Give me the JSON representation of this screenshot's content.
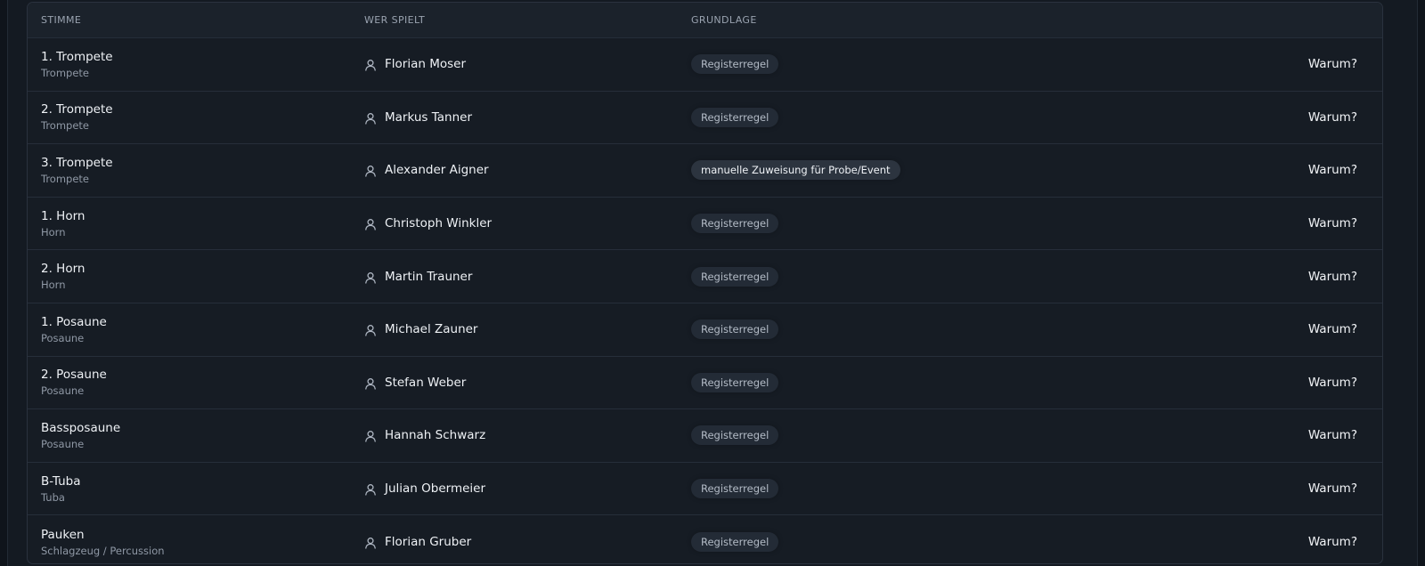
{
  "header": {
    "col_stimme": "STIMME",
    "col_wer": "WER SPIELT",
    "col_grundlage": "GRUNDLAGE"
  },
  "rows": [
    {
      "voice": "1. Trompete",
      "section": "Trompete",
      "player": "Florian Moser",
      "basis": "Registerregel",
      "manual": false,
      "action": "Warum?"
    },
    {
      "voice": "2. Trompete",
      "section": "Trompete",
      "player": "Markus Tanner",
      "basis": "Registerregel",
      "manual": false,
      "action": "Warum?"
    },
    {
      "voice": "3. Trompete",
      "section": "Trompete",
      "player": "Alexander Aigner",
      "basis": "manuelle Zuweisung für Probe/Event",
      "manual": true,
      "action": "Warum?"
    },
    {
      "voice": "1. Horn",
      "section": "Horn",
      "player": "Christoph Winkler",
      "basis": "Registerregel",
      "manual": false,
      "action": "Warum?"
    },
    {
      "voice": "2. Horn",
      "section": "Horn",
      "player": "Martin Trauner",
      "basis": "Registerregel",
      "manual": false,
      "action": "Warum?"
    },
    {
      "voice": "1. Posaune",
      "section": "Posaune",
      "player": "Michael Zauner",
      "basis": "Registerregel",
      "manual": false,
      "action": "Warum?"
    },
    {
      "voice": "2. Posaune",
      "section": "Posaune",
      "player": "Stefan Weber",
      "basis": "Registerregel",
      "manual": false,
      "action": "Warum?"
    },
    {
      "voice": "Bassposaune",
      "section": "Posaune",
      "player": "Hannah Schwarz",
      "basis": "Registerregel",
      "manual": false,
      "action": "Warum?"
    },
    {
      "voice": "B-Tuba",
      "section": "Tuba",
      "player": "Julian Obermeier",
      "basis": "Registerregel",
      "manual": false,
      "action": "Warum?"
    },
    {
      "voice": "Pauken",
      "section": "Schlagzeug / Percussion",
      "player": "Florian Gruber",
      "basis": "Registerregel",
      "manual": false,
      "action": "Warum?"
    }
  ],
  "icons": {
    "player_icon": "user-icon"
  },
  "colors": {
    "background": "#0f141b",
    "card": "#161c24",
    "badge": "#232b36",
    "badge_manual": "#2c343f",
    "text": "#eef1f5",
    "muted": "#8f98a5"
  }
}
